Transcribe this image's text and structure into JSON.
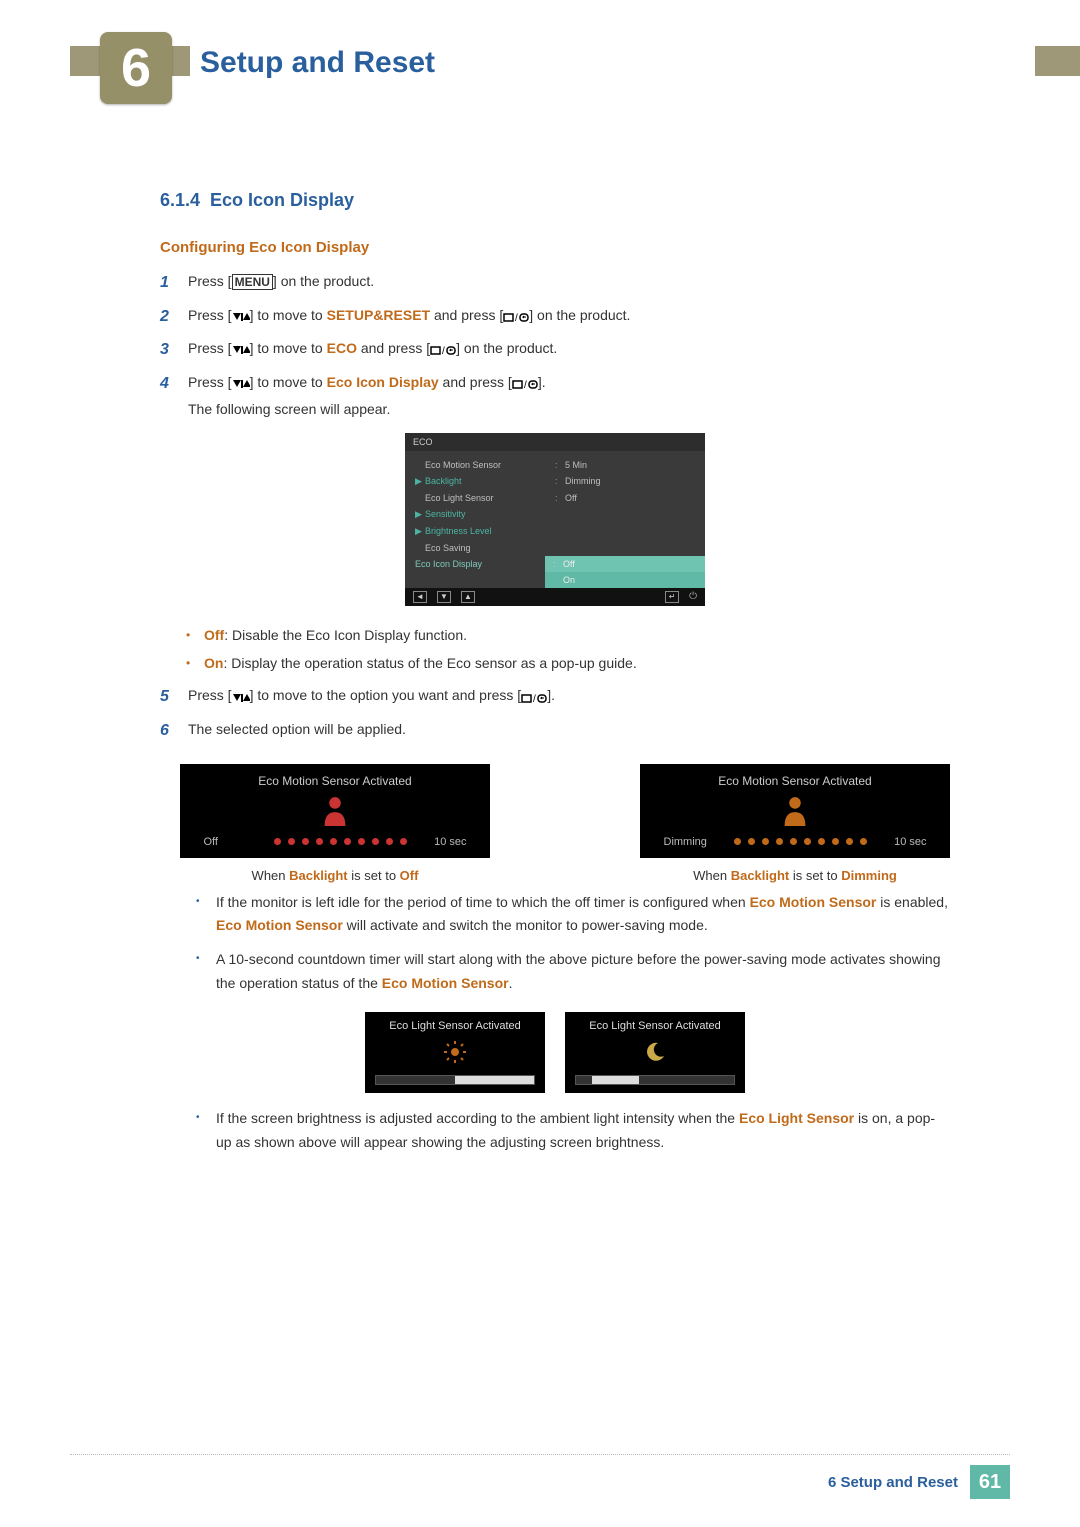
{
  "chapter": {
    "number": "6",
    "title": "Setup and Reset"
  },
  "section": {
    "number": "6.1.4",
    "title": "Eco Icon Display"
  },
  "subheading": "Configuring Eco Icon Display",
  "steps": {
    "s1": {
      "num": "1",
      "pre": "Press [",
      "menu": "MENU",
      "post": "] on the product."
    },
    "s2": {
      "num": "2",
      "pre": "Press [",
      "mid": "] to move to ",
      "target": "SETUP&RESET",
      "aft": " and press [",
      "post": "] on the product."
    },
    "s3": {
      "num": "3",
      "pre": "Press [",
      "mid": "] to move to ",
      "target": "ECO",
      "aft": " and press [",
      "post": "] on the product."
    },
    "s4": {
      "num": "4",
      "pre": "Press [",
      "mid": "] to move to ",
      "target": "Eco Icon Display",
      "aft": " and press [",
      "post": "].",
      "tail": "The following screen will appear."
    },
    "s5": {
      "num": "5",
      "pre": "Press [",
      "mid": "] to move to the option you want and press [",
      "post": "]."
    },
    "s6": {
      "num": "6",
      "text": "The selected option will be applied."
    }
  },
  "osd": {
    "title": "ECO",
    "rows": {
      "motion": {
        "label": "Eco Motion Sensor",
        "val": "5 Min"
      },
      "backlight": {
        "label": "Backlight",
        "val": "Dimming"
      },
      "light": {
        "label": "Eco Light Sensor",
        "val": "Off"
      },
      "sens": {
        "label": "Sensitivity"
      },
      "bright": {
        "label": "Brightness Level"
      },
      "saving": {
        "label": "Eco Saving"
      },
      "icon": {
        "label": "Eco Icon Display",
        "off": "Off",
        "on": "On"
      }
    }
  },
  "optbullets": {
    "off_label": "Off",
    "off_text": ": Disable the Eco Icon Display function.",
    "on_label": "On",
    "on_text": ": Display the operation status of the Eco sensor as a pop-up guide."
  },
  "popup": {
    "title": "Eco Motion Sensor Activated",
    "off": "Off",
    "dimming": "Dimming",
    "ten": "10 sec",
    "cap_off_pre": "When ",
    "cap_off_b1": "Backlight",
    "cap_off_mid": " is set to ",
    "cap_off_b2": "Off",
    "cap_dim_b2": "Dimming"
  },
  "info": {
    "p1a": "If the monitor is left idle for the period of time to which the off timer is configured when ",
    "p1b": "Eco Motion Sensor",
    "p1c": " is enabled, ",
    "p1d": "Eco Motion Sensor",
    "p1e": " will activate and switch the monitor to power-saving mode.",
    "p2a": "A 10-second countdown timer will start along with the above picture before the power-saving mode activates showing the operation status of the ",
    "p2b": "Eco Motion Sensor",
    "p2c": "."
  },
  "popup2": {
    "title": "Eco Light Sensor Activated"
  },
  "info2": {
    "a": "If the screen brightness is adjusted according to the ambient light intensity when the ",
    "b": "Eco Light Sensor",
    "c": " is on, a pop-up as shown above will appear showing the adjusting screen brightness."
  },
  "footer": {
    "text": "6 Setup and Reset",
    "page": "61"
  }
}
